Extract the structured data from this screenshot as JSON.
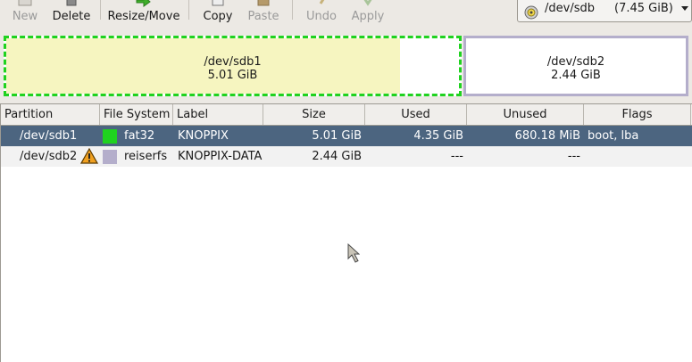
{
  "toolbar": {
    "new_label": "New",
    "delete_label": "Delete",
    "resize_label": "Resize/Move",
    "copy_label": "Copy",
    "paste_label": "Paste",
    "undo_label": "Undo",
    "apply_label": "Apply"
  },
  "device": {
    "name": "/dev/sdb",
    "size": "(7.45 GiB)",
    "icon": "disk-icon"
  },
  "map": {
    "partitions": [
      {
        "name": "/dev/sdb1",
        "size": "5.01 GiB",
        "used_fraction": 0.87,
        "color": "#1fd21f"
      },
      {
        "name": "/dev/sdb2",
        "size": "2.44 GiB",
        "color": "#b4aecb"
      }
    ]
  },
  "table": {
    "columns": [
      "Partition",
      "File System",
      "Label",
      "Size",
      "Used",
      "Unused",
      "Flags"
    ],
    "rows": [
      {
        "partition": "/dev/sdb1",
        "filesystem": "fat32",
        "fs_color": "#1fd21f",
        "label": "KNOPPIX",
        "size": "5.01 GiB",
        "used": "4.35 GiB",
        "unused": "680.18 MiB",
        "flags": "boot, lba",
        "warning": false,
        "selected": true
      },
      {
        "partition": "/dev/sdb2",
        "filesystem": "reiserfs",
        "fs_color": "#b4aecb",
        "label": "KNOPPIX-DATA",
        "size": "2.44 GiB",
        "used": "---",
        "unused": "---",
        "flags": "",
        "warning": true,
        "selected": false
      }
    ]
  },
  "colors": {
    "selection": "#4c6580",
    "used_space": "#f6f5c0"
  }
}
